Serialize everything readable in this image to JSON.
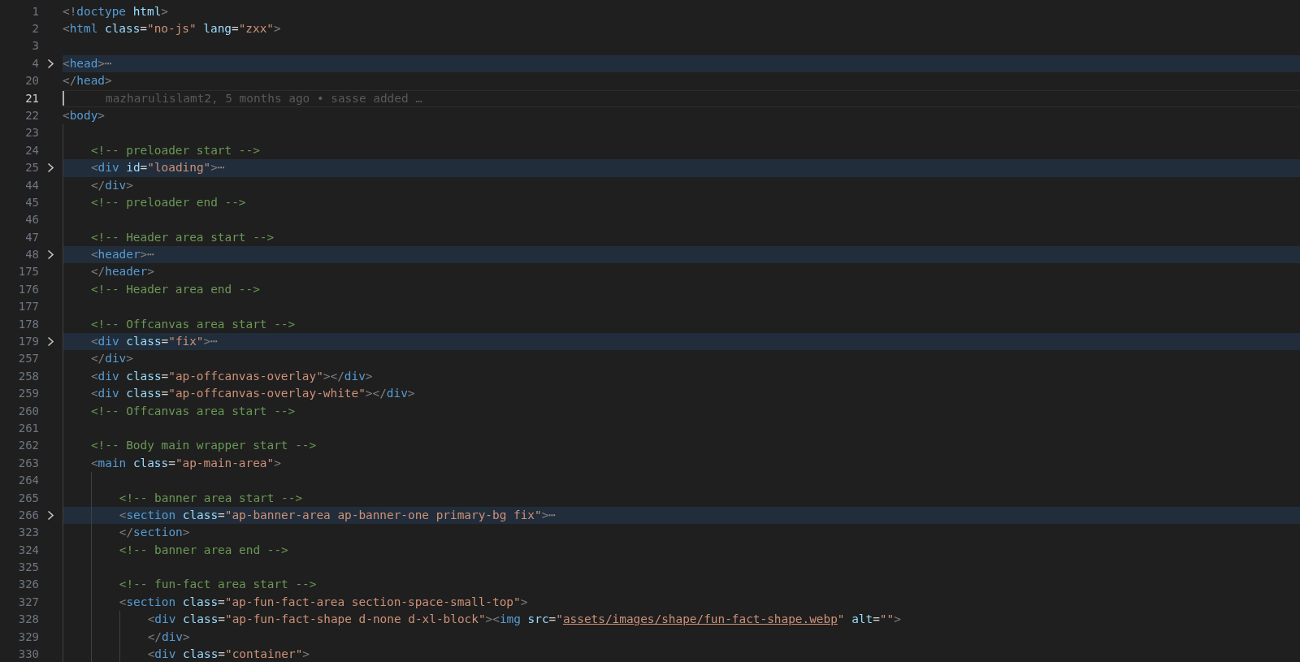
{
  "lines": [
    {
      "number": "1",
      "folded": false,
      "current": false,
      "tokens": [
        {
          "kind": "p",
          "text": "<!"
        },
        {
          "kind": "g",
          "text": "doctype"
        },
        {
          "kind": "a",
          "text": " html"
        },
        {
          "kind": "p",
          "text": ">"
        }
      ]
    },
    {
      "number": "2",
      "folded": false,
      "current": false,
      "tokens": [
        {
          "kind": "p",
          "text": "<"
        },
        {
          "kind": "g",
          "text": "html"
        },
        {
          "kind": "a",
          "text": " class"
        },
        {
          "kind": "x",
          "text": "="
        },
        {
          "kind": "s",
          "text": "\"no-js\""
        },
        {
          "kind": "a",
          "text": " lang"
        },
        {
          "kind": "x",
          "text": "="
        },
        {
          "kind": "s",
          "text": "\"zxx\""
        },
        {
          "kind": "p",
          "text": ">"
        }
      ]
    },
    {
      "number": "3",
      "folded": false,
      "current": false
    },
    {
      "number": "4",
      "folded": true,
      "current": false,
      "tokens": [
        {
          "kind": "p",
          "text": "<"
        },
        {
          "kind": "g",
          "text": "head"
        },
        {
          "kind": "p",
          "text": ">"
        },
        {
          "kind": "e",
          "text": "⋯"
        }
      ]
    },
    {
      "number": "20",
      "folded": false,
      "current": false,
      "tokens": [
        {
          "kind": "p",
          "text": "</"
        },
        {
          "kind": "g",
          "text": "head"
        },
        {
          "kind": "p",
          "text": ">"
        }
      ]
    },
    {
      "number": "21",
      "folded": false,
      "current": true,
      "blame": "mazharulislamt2, 5 months ago • sasse added …"
    },
    {
      "number": "22",
      "folded": false,
      "current": false,
      "tokens": [
        {
          "kind": "p",
          "text": "<"
        },
        {
          "kind": "g",
          "text": "body"
        },
        {
          "kind": "p",
          "text": ">"
        }
      ],
      "children": [
        {
          "number": "23",
          "folded": false,
          "current": false
        },
        {
          "number": "24",
          "folded": false,
          "current": false,
          "tokens": [
            {
              "kind": "c",
              "text": "<!-- preloader start -->"
            }
          ]
        },
        {
          "number": "25",
          "folded": true,
          "current": false,
          "tokens": [
            {
              "kind": "p",
              "text": "<"
            },
            {
              "kind": "g",
              "text": "div"
            },
            {
              "kind": "a",
              "text": " id"
            },
            {
              "kind": "x",
              "text": "="
            },
            {
              "kind": "s",
              "text": "\"loading\""
            },
            {
              "kind": "p",
              "text": ">"
            },
            {
              "kind": "e",
              "text": "⋯"
            }
          ]
        },
        {
          "number": "44",
          "folded": false,
          "current": false,
          "tokens": [
            {
              "kind": "p",
              "text": "</"
            },
            {
              "kind": "g",
              "text": "div"
            },
            {
              "kind": "p",
              "text": ">"
            }
          ]
        },
        {
          "number": "45",
          "folded": false,
          "current": false,
          "tokens": [
            {
              "kind": "c",
              "text": "<!-- preloader end -->"
            }
          ]
        },
        {
          "number": "46",
          "folded": false,
          "current": false
        },
        {
          "number": "47",
          "folded": false,
          "current": false,
          "tokens": [
            {
              "kind": "c",
              "text": "<!-- Header area start -->"
            }
          ]
        },
        {
          "number": "48",
          "folded": true,
          "current": false,
          "tokens": [
            {
              "kind": "p",
              "text": "<"
            },
            {
              "kind": "g",
              "text": "header"
            },
            {
              "kind": "p",
              "text": ">"
            },
            {
              "kind": "e",
              "text": "⋯"
            }
          ]
        },
        {
          "number": "175",
          "folded": false,
          "current": false,
          "tokens": [
            {
              "kind": "p",
              "text": "</"
            },
            {
              "kind": "g",
              "text": "header"
            },
            {
              "kind": "p",
              "text": ">"
            }
          ]
        },
        {
          "number": "176",
          "folded": false,
          "current": false,
          "tokens": [
            {
              "kind": "c",
              "text": "<!-- Header area end -->"
            }
          ]
        },
        {
          "number": "177",
          "folded": false,
          "current": false
        },
        {
          "number": "178",
          "folded": false,
          "current": false,
          "tokens": [
            {
              "kind": "c",
              "text": "<!-- Offcanvas area start -->"
            }
          ]
        },
        {
          "number": "179",
          "folded": true,
          "current": false,
          "tokens": [
            {
              "kind": "p",
              "text": "<"
            },
            {
              "kind": "g",
              "text": "div"
            },
            {
              "kind": "a",
              "text": " class"
            },
            {
              "kind": "x",
              "text": "="
            },
            {
              "kind": "s",
              "text": "\"fix\""
            },
            {
              "kind": "p",
              "text": ">"
            },
            {
              "kind": "e",
              "text": "⋯"
            }
          ]
        },
        {
          "number": "257",
          "folded": false,
          "current": false,
          "tokens": [
            {
              "kind": "p",
              "text": "</"
            },
            {
              "kind": "g",
              "text": "div"
            },
            {
              "kind": "p",
              "text": ">"
            }
          ]
        },
        {
          "number": "258",
          "folded": false,
          "current": false,
          "tokens": [
            {
              "kind": "p",
              "text": "<"
            },
            {
              "kind": "g",
              "text": "div"
            },
            {
              "kind": "a",
              "text": " class"
            },
            {
              "kind": "x",
              "text": "="
            },
            {
              "kind": "s",
              "text": "\"ap-offcanvas-overlay\""
            },
            {
              "kind": "p",
              "text": "></"
            },
            {
              "kind": "g",
              "text": "div"
            },
            {
              "kind": "p",
              "text": ">"
            }
          ]
        },
        {
          "number": "259",
          "folded": false,
          "current": false,
          "tokens": [
            {
              "kind": "p",
              "text": "<"
            },
            {
              "kind": "g",
              "text": "div"
            },
            {
              "kind": "a",
              "text": " class"
            },
            {
              "kind": "x",
              "text": "="
            },
            {
              "kind": "s",
              "text": "\"ap-offcanvas-overlay-white\""
            },
            {
              "kind": "p",
              "text": "></"
            },
            {
              "kind": "g",
              "text": "div"
            },
            {
              "kind": "p",
              "text": ">"
            }
          ]
        },
        {
          "number": "260",
          "folded": false,
          "current": false,
          "tokens": [
            {
              "kind": "c",
              "text": "<!-- Offcanvas area start -->"
            }
          ]
        },
        {
          "number": "261",
          "folded": false,
          "current": false
        },
        {
          "number": "262",
          "folded": false,
          "current": false,
          "tokens": [
            {
              "kind": "c",
              "text": "<!-- Body main wrapper start -->"
            }
          ]
        },
        {
          "number": "263",
          "folded": false,
          "current": false,
          "tokens": [
            {
              "kind": "p",
              "text": "<"
            },
            {
              "kind": "g",
              "text": "main"
            },
            {
              "kind": "a",
              "text": " class"
            },
            {
              "kind": "x",
              "text": "="
            },
            {
              "kind": "s",
              "text": "\"ap-main-area\""
            },
            {
              "kind": "p",
              "text": ">"
            }
          ],
          "children": [
            {
              "number": "264",
              "folded": false,
              "current": false
            },
            {
              "number": "265",
              "folded": false,
              "current": false,
              "tokens": [
                {
                  "kind": "c",
                  "text": "<!-- banner area start -->"
                }
              ]
            },
            {
              "number": "266",
              "folded": true,
              "current": false,
              "tokens": [
                {
                  "kind": "p",
                  "text": "<"
                },
                {
                  "kind": "g",
                  "text": "section"
                },
                {
                  "kind": "a",
                  "text": " class"
                },
                {
                  "kind": "x",
                  "text": "="
                },
                {
                  "kind": "s",
                  "text": "\"ap-banner-area ap-banner-one primary-bg fix\""
                },
                {
                  "kind": "p",
                  "text": ">"
                },
                {
                  "kind": "e",
                  "text": "⋯"
                }
              ]
            },
            {
              "number": "323",
              "folded": false,
              "current": false,
              "tokens": [
                {
                  "kind": "p",
                  "text": "</"
                },
                {
                  "kind": "g",
                  "text": "section"
                },
                {
                  "kind": "p",
                  "text": ">"
                }
              ]
            },
            {
              "number": "324",
              "folded": false,
              "current": false,
              "tokens": [
                {
                  "kind": "c",
                  "text": "<!-- banner area end -->"
                }
              ]
            },
            {
              "number": "325",
              "folded": false,
              "current": false
            },
            {
              "number": "326",
              "folded": false,
              "current": false,
              "tokens": [
                {
                  "kind": "c",
                  "text": "<!-- fun-fact area start -->"
                }
              ]
            },
            {
              "number": "327",
              "folded": false,
              "current": false,
              "tokens": [
                {
                  "kind": "p",
                  "text": "<"
                },
                {
                  "kind": "g",
                  "text": "section"
                },
                {
                  "kind": "a",
                  "text": " class"
                },
                {
                  "kind": "x",
                  "text": "="
                },
                {
                  "kind": "s",
                  "text": "\"ap-fun-fact-area section-space-small-top\""
                },
                {
                  "kind": "p",
                  "text": ">"
                }
              ],
              "children": [
                {
                  "number": "328",
                  "folded": false,
                  "current": false,
                  "tokens": [
                    {
                      "kind": "p",
                      "text": "<"
                    },
                    {
                      "kind": "g",
                      "text": "div"
                    },
                    {
                      "kind": "a",
                      "text": " class"
                    },
                    {
                      "kind": "x",
                      "text": "="
                    },
                    {
                      "kind": "s",
                      "text": "\"ap-fun-fact-shape d-none d-xl-block\""
                    },
                    {
                      "kind": "p",
                      "text": "><"
                    },
                    {
                      "kind": "g",
                      "text": "img"
                    },
                    {
                      "kind": "a",
                      "text": " src"
                    },
                    {
                      "kind": "x",
                      "text": "="
                    },
                    {
                      "kind": "s",
                      "text": "\""
                    },
                    {
                      "kind": "u",
                      "text": "assets/images/shape/fun-fact-shape.webp"
                    },
                    {
                      "kind": "s",
                      "text": "\""
                    },
                    {
                      "kind": "a",
                      "text": " alt"
                    },
                    {
                      "kind": "x",
                      "text": "="
                    },
                    {
                      "kind": "s",
                      "text": "\"\""
                    },
                    {
                      "kind": "p",
                      "text": ">"
                    }
                  ]
                },
                {
                  "number": "329",
                  "folded": false,
                  "current": false,
                  "tokens": [
                    {
                      "kind": "p",
                      "text": "</"
                    },
                    {
                      "kind": "g",
                      "text": "div"
                    },
                    {
                      "kind": "p",
                      "text": ">"
                    }
                  ]
                },
                {
                  "number": "330",
                  "folded": false,
                  "current": false,
                  "tokens": [
                    {
                      "kind": "p",
                      "text": "<"
                    },
                    {
                      "kind": "g",
                      "text": "div"
                    },
                    {
                      "kind": "a",
                      "text": " class"
                    },
                    {
                      "kind": "x",
                      "text": "="
                    },
                    {
                      "kind": "s",
                      "text": "\"container\""
                    },
                    {
                      "kind": "p",
                      "text": ">"
                    }
                  ]
                }
              ]
            }
          ]
        }
      ]
    }
  ]
}
